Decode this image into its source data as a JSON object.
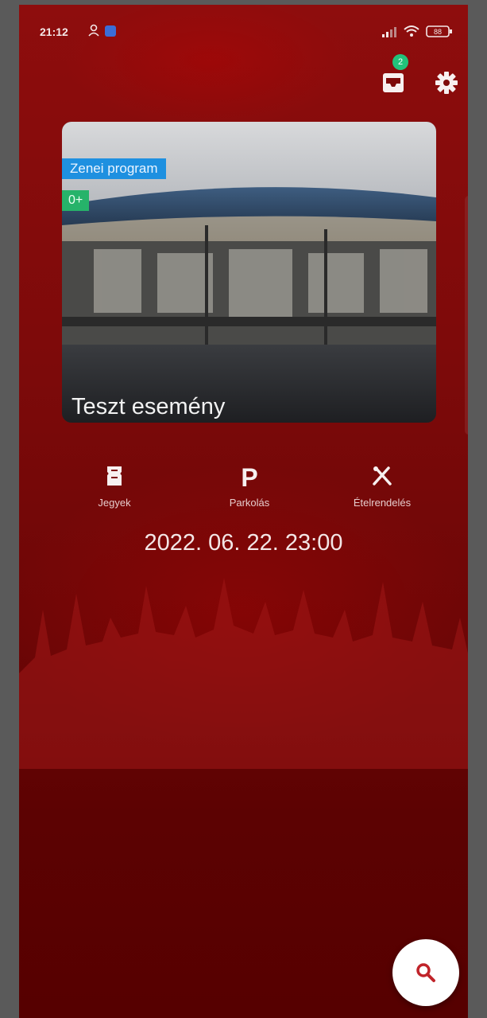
{
  "status_bar": {
    "time": "21:12",
    "battery": "88"
  },
  "header": {
    "inbox_badge_count": "2"
  },
  "event_card": {
    "category_tag": "Zenei program",
    "age_tag": "0+",
    "title": "Teszt esemény"
  },
  "actions": [
    {
      "label": "Jegyek",
      "icon": "ticket-icon"
    },
    {
      "label": "Parkolás",
      "icon": "parking-icon"
    },
    {
      "label": "Ételrendelés",
      "icon": "fork-knife-icon"
    }
  ],
  "event_date": "2022. 06. 22. 23:00",
  "fab": {
    "icon": "search-icon"
  },
  "colors": {
    "background": "#7d0a0a",
    "category_tag": "#1e90e0",
    "age_tag": "#26b36a",
    "badge": "#22c27a",
    "fab": "#ffffff",
    "fab_icon": "#c0242a"
  }
}
